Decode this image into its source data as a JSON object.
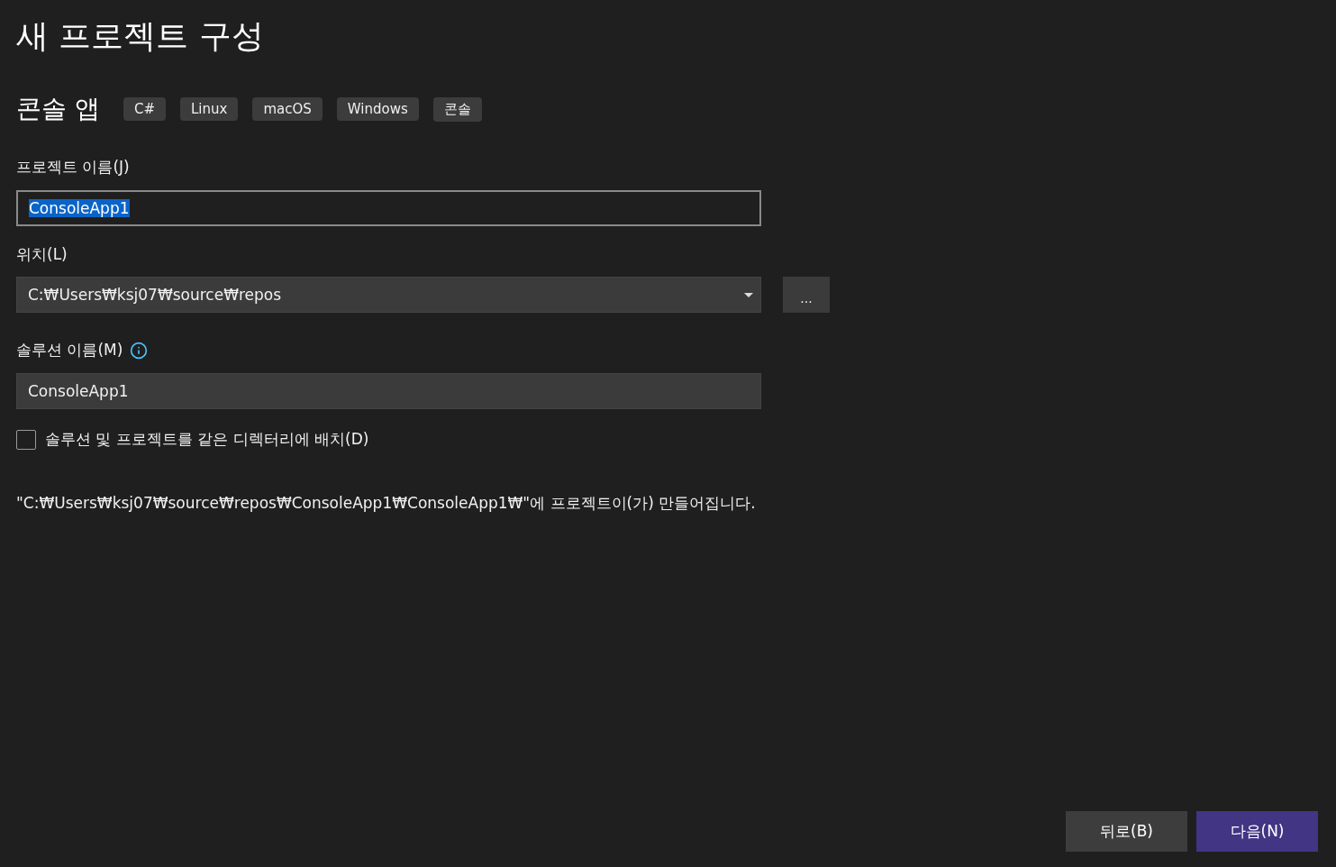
{
  "title": "새 프로젝트 구성",
  "template": {
    "name": "콘솔 앱",
    "tags": [
      "C#",
      "Linux",
      "macOS",
      "Windows",
      "콘솔"
    ]
  },
  "project_name": {
    "label": "프로젝트 이름(J)",
    "value": "ConsoleApp1",
    "text_selected": true
  },
  "location": {
    "label": "위치(L)",
    "value": "C:₩Users₩ksj07₩source₩repos",
    "browse": "..."
  },
  "solution_name": {
    "label": "솔루션 이름(M)",
    "value": "ConsoleApp1"
  },
  "same_directory": {
    "label": "솔루션 및 프로젝트를 같은 디렉터리에 배치(D)",
    "checked": false
  },
  "summary": "\"C:₩Users₩ksj07₩source₩repos₩ConsoleApp1₩ConsoleApp1₩\"에 프로젝트이(가) 만들어집니다.",
  "buttons": [
    {
      "label": "뒤로(B)",
      "kind": "secondary"
    },
    {
      "label": "다음(N)",
      "kind": "primary"
    }
  ]
}
